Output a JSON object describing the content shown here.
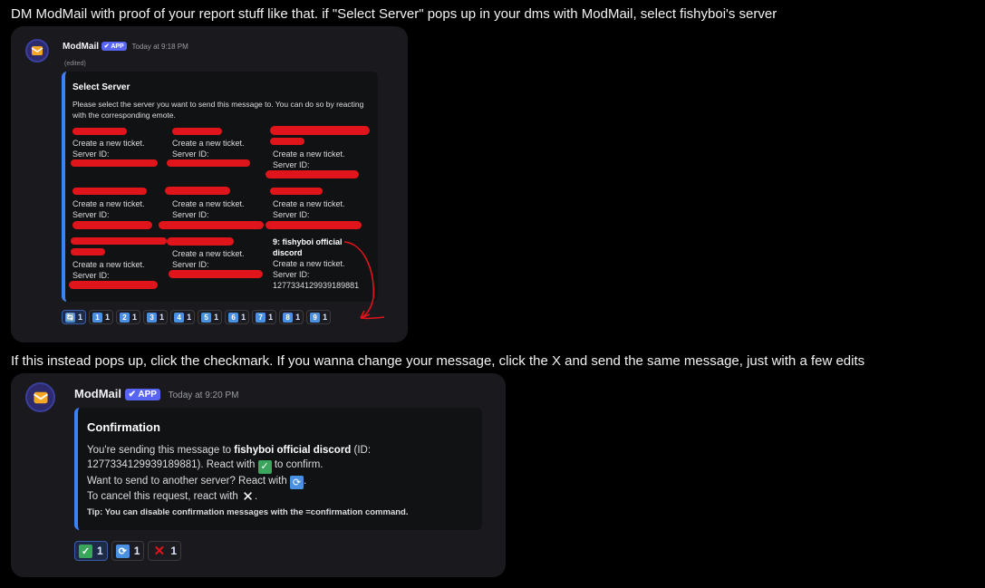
{
  "captions": {
    "top": "DM ModMail with proof of your report stuff like that. if \"Select Server\" pops up in your dms with ModMail, select fishyboi's server",
    "middle": "If this instead pops up, click the checkmark. If you wanna change your message, click the X and send the same message, just with a few edits"
  },
  "message1": {
    "author": "ModMail",
    "badge": "✔ APP",
    "timestamp": "Today at 9:18 PM",
    "edited": "(edited)",
    "embed": {
      "title": "Select Server",
      "description": "Please select the server you want to send this message to. You can do so by reacting with the corresponding emote.",
      "create_ticket": "Create a new ticket.",
      "server_id_label": "Server ID:",
      "highlight_line1": "9: fishyboi official",
      "highlight_line2": "discord",
      "highlight_id": "1277334129939189881"
    },
    "reactions": [
      {
        "emoji": "refresh-icon",
        "glyph": "🔄",
        "count": "1"
      },
      {
        "emoji": "keycap-1-icon",
        "glyph": "1",
        "count": "1"
      },
      {
        "emoji": "keycap-2-icon",
        "glyph": "2",
        "count": "1"
      },
      {
        "emoji": "keycap-3-icon",
        "glyph": "3",
        "count": "1"
      },
      {
        "emoji": "keycap-4-icon",
        "glyph": "4",
        "count": "1"
      },
      {
        "emoji": "keycap-5-icon",
        "glyph": "5",
        "count": "1"
      },
      {
        "emoji": "keycap-6-icon",
        "glyph": "6",
        "count": "1"
      },
      {
        "emoji": "keycap-7-icon",
        "glyph": "7",
        "count": "1"
      },
      {
        "emoji": "keycap-8-icon",
        "glyph": "8",
        "count": "1"
      },
      {
        "emoji": "keycap-9-icon",
        "glyph": "9",
        "count": "1"
      }
    ]
  },
  "message2": {
    "author": "ModMail",
    "badge": "✔ APP",
    "timestamp": "Today at 9:20 PM",
    "embed": {
      "title": "Confirmation",
      "line1_a": "You're sending this message to ",
      "line1_bold": "fishyboi official discord",
      "line1_b": " (ID:",
      "line2_a": "1277334129939189881). React with ",
      "line2_b": " to confirm.",
      "line3_a": "Want to send to another server? React with ",
      "line3_b": ".",
      "line4_a": "To cancel this request, react with ",
      "line4_b": ".",
      "tip": "Tip: You can disable confirmation messages with the =confirmation command."
    },
    "reactions": [
      {
        "emoji": "check-mark-icon",
        "glyph": "✓",
        "count": "1"
      },
      {
        "emoji": "refresh-icon",
        "glyph": "⟳",
        "count": "1"
      },
      {
        "emoji": "cross-mark-icon",
        "glyph": "✕",
        "count": "1"
      }
    ]
  },
  "colors": {
    "accent": "#5865f2",
    "embed_border": "#3b82f6",
    "redaction": "#e0141b",
    "annotation_arrow": "#e0141b"
  }
}
